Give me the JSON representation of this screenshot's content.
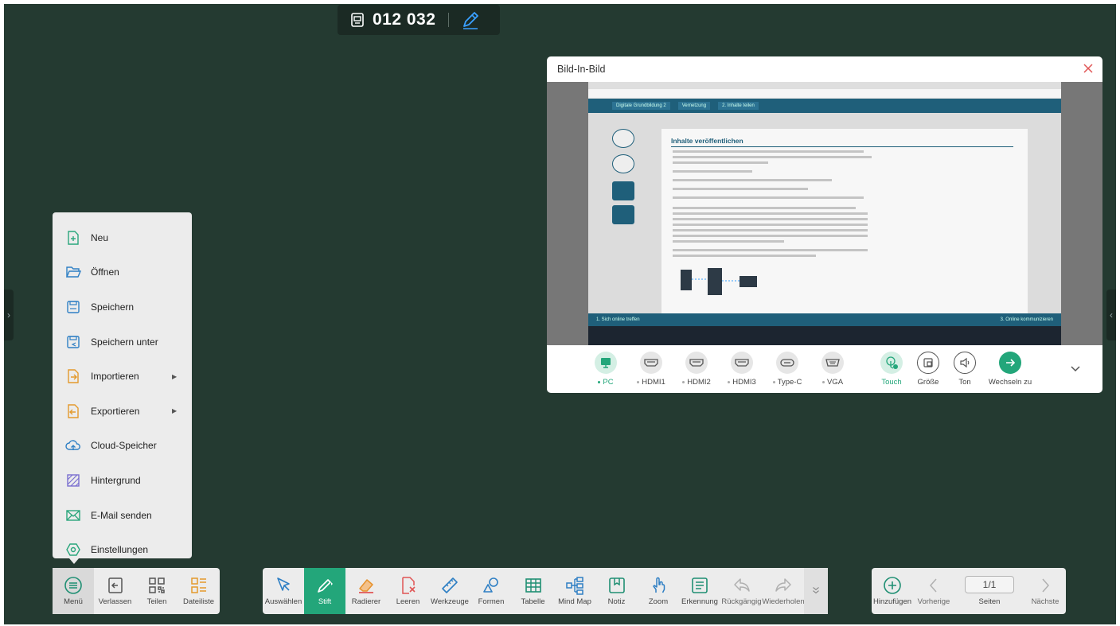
{
  "top_bar": {
    "code": "012 032"
  },
  "menu": {
    "items": [
      {
        "label": "Neu",
        "icon": "file-plus-icon"
      },
      {
        "label": "Öffnen",
        "icon": "folder-open-icon"
      },
      {
        "label": "Speichern",
        "icon": "save-icon"
      },
      {
        "label": "Speichern unter",
        "icon": "save-as-icon"
      },
      {
        "label": "Importieren",
        "icon": "import-icon",
        "submenu": true
      },
      {
        "label": "Exportieren",
        "icon": "export-icon",
        "submenu": true
      },
      {
        "label": "Cloud-Speicher",
        "icon": "cloud-icon"
      },
      {
        "label": "Hintergrund",
        "icon": "background-icon"
      },
      {
        "label": "E-Mail senden",
        "icon": "mail-icon"
      },
      {
        "label": "Einstellungen",
        "icon": "settings-icon"
      }
    ]
  },
  "left_bar": {
    "menu": "Menü",
    "leave": "Verlassen",
    "share": "Teilen",
    "file_list": "Dateiliste"
  },
  "main_bar": {
    "select": "Auswählen",
    "pen": "Stift",
    "eraser": "Radierer",
    "clear": "Leeren",
    "tools": "Werkzeuge",
    "shapes": "Formen",
    "table": "Tabelle",
    "mindmap": "Mind Map",
    "note": "Notiz",
    "zoom": "Zoom",
    "recognition": "Erkennung",
    "undo": "Rückgängig",
    "redo": "Wiederholen"
  },
  "page_bar": {
    "add": "Hinzufügen",
    "prev": "Vorherige",
    "pages_value": "1/1",
    "pages_label": "Seiten",
    "next": "Nächste"
  },
  "pip": {
    "title": "Bild-In-Bild",
    "sources": [
      {
        "label": "PC",
        "selected": true
      },
      {
        "label": "HDMI1"
      },
      {
        "label": "HDMI2"
      },
      {
        "label": "HDMI3"
      },
      {
        "label": "Type-C"
      },
      {
        "label": "VGA"
      }
    ],
    "controls": {
      "touch": "Touch",
      "size": "Größe",
      "sound": "Ton",
      "switch": "Wechseln zu"
    },
    "screen": {
      "nav_items": [
        "Digitale Grundbildung 2",
        "Vernetzung",
        "2. Inhalte teilen"
      ],
      "heading": "Inhalte veröffentlichen",
      "footer_left": "1. Sich online treffen",
      "footer_right": "3. Online kommunizieren"
    }
  },
  "colors": {
    "board": "#243a31",
    "accent": "#23a67a",
    "eraser": "#e6922e",
    "clear": "#e05555",
    "tool_icon": "#1f8f73"
  }
}
